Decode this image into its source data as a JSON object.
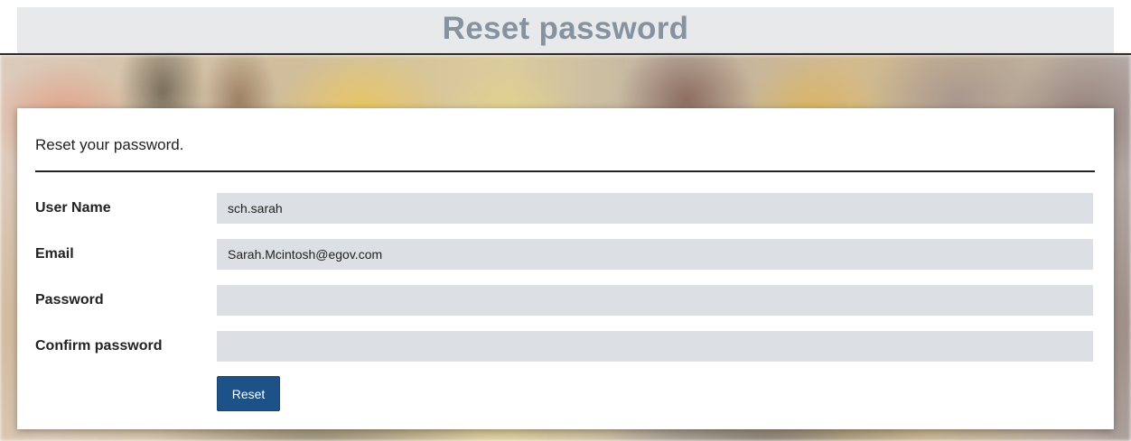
{
  "page": {
    "title": "Reset password"
  },
  "form": {
    "heading": "Reset your password.",
    "fields": [
      {
        "label": "User Name",
        "value": "sch.sarah",
        "type": "text"
      },
      {
        "label": "Email",
        "value": "Sarah.Mcintosh@egov.com",
        "type": "text"
      },
      {
        "label": "Password",
        "value": "",
        "type": "password"
      },
      {
        "label": "Confirm password",
        "value": "",
        "type": "password"
      }
    ],
    "submit_label": "Reset"
  },
  "colors": {
    "title_text": "#8593a1",
    "title_bar_bg": "#e8e9eb",
    "input_bg": "#dcdfe3",
    "button_bg": "#1d5289",
    "button_text": "#ffffff"
  }
}
